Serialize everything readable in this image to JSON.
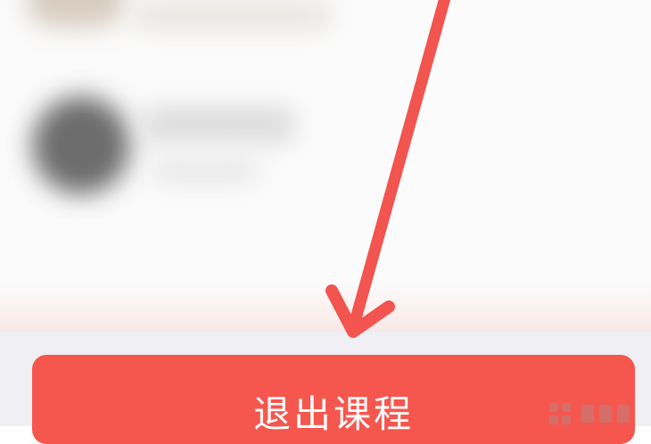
{
  "exit_button": {
    "label": "退出课程",
    "color": "#f5574f",
    "text_color": "#ffffff"
  },
  "annotation": {
    "arrow_color": "#f25450",
    "arrow_icon": "arrow-down-icon"
  },
  "watermark": {
    "icon": "watermark-logo-icon"
  }
}
